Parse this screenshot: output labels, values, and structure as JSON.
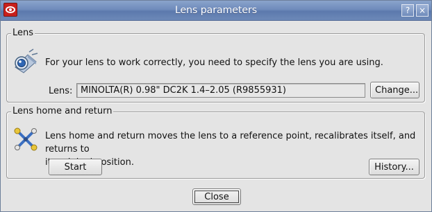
{
  "window": {
    "title": "Lens parameters",
    "help_label": "?",
    "close_label": "×"
  },
  "lens_group": {
    "title": "Lens",
    "description": "For your lens to work correctly, you need to specify the lens you are using.",
    "lens_label": "Lens:",
    "lens_value": "MINOLTA(R) 0.98\" DC2K 1.4–2.05 (R9855931)",
    "change_label": "Change...",
    "icon": "lens-projector-icon"
  },
  "home_group": {
    "title": "Lens home and return",
    "description_line1": "Lens home and return moves the lens to a reference point, recalibrates itself, and returns to",
    "description_line2": "its original position.",
    "start_label": "Start",
    "history_label": "History...",
    "icon": "crossed-tools-icon"
  },
  "footer": {
    "close_label": "Close"
  },
  "colors": {
    "titlebar": "#6f8bbb",
    "app_icon": "#c8201c",
    "background": "#e4e4e4"
  }
}
